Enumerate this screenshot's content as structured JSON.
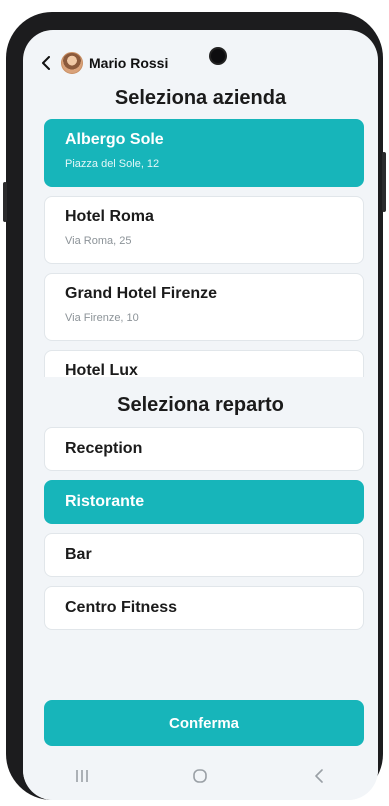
{
  "header": {
    "user_name": "Mario Rossi",
    "icons": {
      "back": "chevron-left-icon",
      "avatar": "user-avatar"
    }
  },
  "companies": {
    "title": "Seleziona azienda",
    "items": [
      {
        "name": "Albergo Sole",
        "address": "Piazza del Sole, 12",
        "selected": true
      },
      {
        "name": "Hotel Roma",
        "address": "Via Roma, 25",
        "selected": false
      },
      {
        "name": "Grand Hotel Firenze",
        "address": "Via Firenze, 10",
        "selected": false
      },
      {
        "name": "Hotel Lux",
        "address": "",
        "selected": false
      }
    ]
  },
  "departments": {
    "title": "Seleziona reparto",
    "items": [
      {
        "label": "Reception",
        "selected": false
      },
      {
        "label": "Ristorante",
        "selected": true
      },
      {
        "label": "Bar",
        "selected": false
      },
      {
        "label": "Centro Fitness",
        "selected": false
      }
    ]
  },
  "actions": {
    "confirm_label": "Conferma"
  },
  "system_nav": {
    "icons": [
      "recent-apps-icon",
      "home-icon",
      "back-icon"
    ]
  },
  "colors": {
    "accent": "#17b5ba",
    "background": "#f2f5f8",
    "card": "#ffffff",
    "text": "#1b1b1b"
  }
}
